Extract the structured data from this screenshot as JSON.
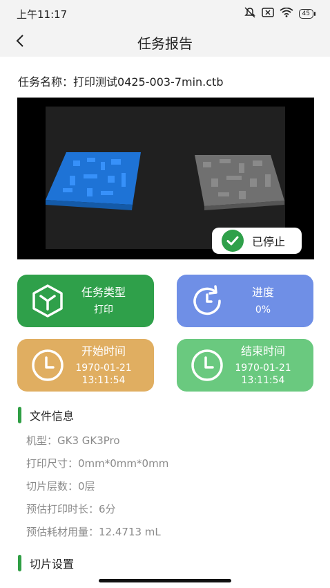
{
  "status_bar": {
    "time": "上午11:17",
    "battery": "45"
  },
  "header": {
    "title": "任务报告"
  },
  "task": {
    "name_label": "任务名称：",
    "name_value": "打印测试0425-003-7min.ctb"
  },
  "preview": {
    "status_label": "已停止"
  },
  "cards": {
    "task_type": {
      "title": "任务类型",
      "value": "打印",
      "color": "#2fa04a"
    },
    "progress": {
      "title": "进度",
      "value": "0%",
      "color": "#6f8fe6"
    },
    "start_time": {
      "title": "开始时间",
      "date": "1970-01-21",
      "time": "13:11:54",
      "color": "#e0ae61"
    },
    "end_time": {
      "title": "结束时间",
      "date": "1970-01-21",
      "time": "13:11:54",
      "color": "#6ac97f"
    }
  },
  "file_info": {
    "section_title": "文件信息",
    "rows": [
      "机型：GK3 GK3Pro",
      "打印尺寸：0mm*0mm*0mm",
      "切片层数：0层",
      "预估打印时长：6分",
      "预估耗材用量：12.4713 mL"
    ]
  },
  "slice_settings": {
    "section_title": "切片设置"
  }
}
